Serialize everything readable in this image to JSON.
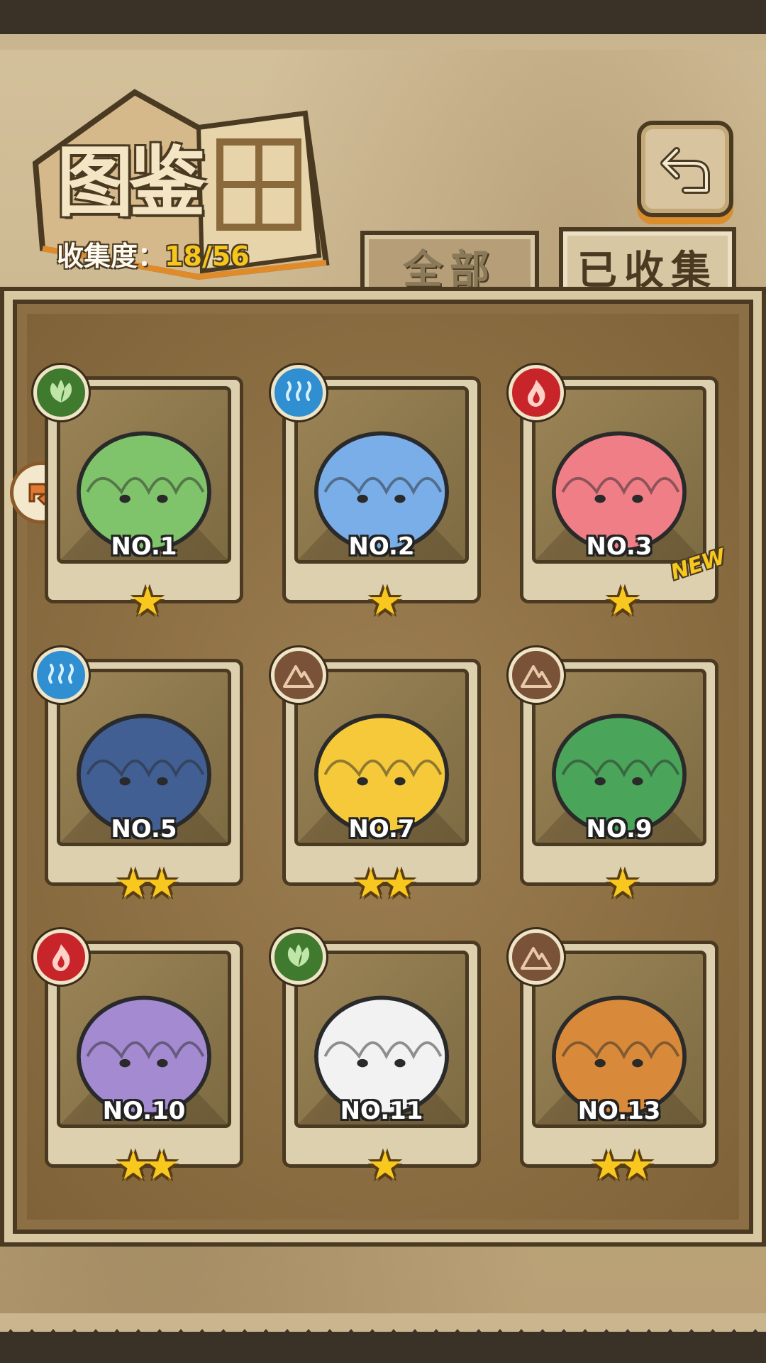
{
  "header": {
    "title": "图鉴",
    "progress_label": "收集度",
    "progress_separator": "：",
    "progress_value": "18/56"
  },
  "tabs": [
    {
      "label": "全部",
      "active": false
    },
    {
      "label": "已收集",
      "active": true
    }
  ],
  "back_button": {
    "icon": "return-arrow-icon"
  },
  "side_tab": {
    "icon": "arrow-tag-icon"
  },
  "colors": {
    "grass": "#3f7a2e",
    "water": "#2f8fd0",
    "fire": "#c8252a",
    "earth": "#7a5238",
    "star": "#f8c81e"
  },
  "cards": [
    {
      "number": "NO.1",
      "element": "grass",
      "stars": "★",
      "new": false,
      "creature_color": "#7fc46a"
    },
    {
      "number": "NO.2",
      "element": "water",
      "stars": "★",
      "new": false,
      "creature_color": "#7aaee8"
    },
    {
      "number": "NO.3",
      "element": "fire",
      "stars": "★",
      "new": true,
      "new_label": "NEW",
      "creature_color": "#ef7e86"
    },
    {
      "number": "NO.5",
      "element": "water",
      "stars": "★★",
      "new": false,
      "creature_color": "#415f92"
    },
    {
      "number": "NO.7",
      "element": "earth",
      "stars": "★★",
      "new": false,
      "creature_color": "#f5c93a"
    },
    {
      "number": "NO.9",
      "element": "earth",
      "stars": "★",
      "new": false,
      "creature_color": "#4aa55a"
    },
    {
      "number": "NO.10",
      "element": "fire",
      "stars": "★★",
      "new": false,
      "creature_color": "#a48ad0"
    },
    {
      "number": "NO.11",
      "element": "grass",
      "stars": "★",
      "new": false,
      "creature_color": "#f2f2f2"
    },
    {
      "number": "NO.13",
      "element": "earth",
      "stars": "★★",
      "new": false,
      "creature_color": "#d88a3a"
    }
  ]
}
